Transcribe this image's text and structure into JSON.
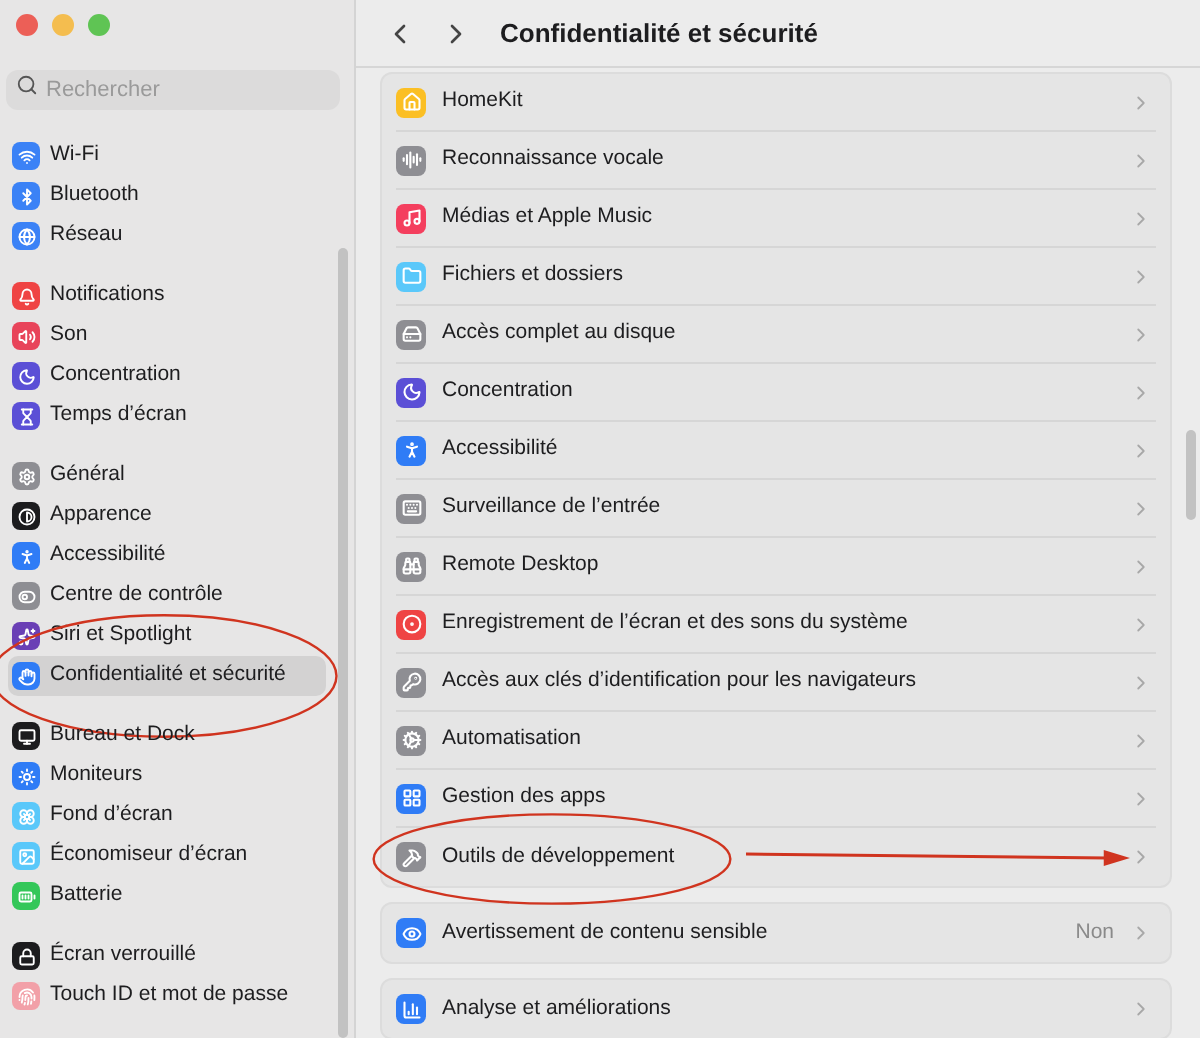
{
  "window": {
    "title": "Confidentialité et sécurité"
  },
  "sidebar": {
    "search": {
      "placeholder": "Rechercher"
    },
    "groups": [
      [
        {
          "label": "Wi-Fi",
          "color": "#3b82f6",
          "selected": false,
          "circled": false
        },
        {
          "label": "Bluetooth",
          "color": "#3b82f6",
          "selected": false,
          "circled": false
        },
        {
          "label": "Réseau",
          "color": "#3b82f6",
          "selected": false,
          "circled": false
        }
      ],
      [
        {
          "label": "Notifications",
          "color": "#ef4444",
          "selected": false,
          "circled": false
        },
        {
          "label": "Son",
          "color": "#e8445a",
          "selected": false,
          "circled": false
        },
        {
          "label": "Concentration",
          "color": "#5b4fd6",
          "selected": false,
          "circled": false
        },
        {
          "label": "Temps d’écran",
          "color": "#5b4fd6",
          "selected": false,
          "circled": false
        }
      ],
      [
        {
          "label": "Général",
          "color": "#8e8e93",
          "selected": false,
          "circled": false
        },
        {
          "label": "Apparence",
          "color": "#1c1c1e",
          "selected": false,
          "circled": false
        },
        {
          "label": "Accessibilité",
          "color": "#2f7cf6",
          "selected": false,
          "circled": false
        },
        {
          "label": "Centre de contrôle",
          "color": "#8e8e93",
          "selected": false,
          "circled": false
        },
        {
          "label": "Siri et Spotlight",
          "color": "#6a3fb5",
          "selected": false,
          "circled": false
        },
        {
          "label": "Confidentialité et sécurité",
          "color": "#2f7cf6",
          "selected": true,
          "circled": true
        }
      ],
      [
        {
          "label": "Bureau et Dock",
          "color": "#1c1c1e",
          "selected": false,
          "circled": false
        },
        {
          "label": "Moniteurs",
          "color": "#2f7cf6",
          "selected": false,
          "circled": false
        },
        {
          "label": "Fond d’écran",
          "color": "#5ac8fa",
          "selected": false,
          "circled": false
        },
        {
          "label": "Économiseur d’écran",
          "color": "#5ac8fa",
          "selected": false,
          "circled": false
        },
        {
          "label": "Batterie",
          "color": "#34c759",
          "selected": false,
          "circled": false
        }
      ],
      [
        {
          "label": "Écran verrouillé",
          "color": "#1c1c1e",
          "selected": false,
          "circled": false
        },
        {
          "label": "Touch ID et mot de passe",
          "color": "#f2a0a8",
          "selected": false,
          "circled": false
        }
      ]
    ]
  },
  "groups": [
    [
      {
        "label": "HomeKit",
        "color": "#fbbf24",
        "circled": false,
        "arrow": false
      },
      {
        "label": "Reconnaissance vocale",
        "color": "#8e8e93",
        "circled": false,
        "arrow": false
      },
      {
        "label": "Médias et Apple Music",
        "color": "#f43f5e",
        "circled": false,
        "arrow": false
      },
      {
        "label": "Fichiers et dossiers",
        "color": "#5ac8fa",
        "circled": false,
        "arrow": false
      },
      {
        "label": "Accès complet au disque",
        "color": "#8e8e93",
        "circled": false,
        "arrow": false
      },
      {
        "label": "Concentration",
        "color": "#5b4fd6",
        "circled": false,
        "arrow": false
      },
      {
        "label": "Accessibilité",
        "color": "#2f7cf6",
        "circled": false,
        "arrow": false
      },
      {
        "label": "Surveillance de l’entrée",
        "color": "#8e8e93",
        "circled": false,
        "arrow": false
      },
      {
        "label": "Remote Desktop",
        "color": "#8e8e93",
        "circled": false,
        "arrow": false
      },
      {
        "label": "Enregistrement de l’écran et des sons du système",
        "color": "#ef4444",
        "circled": false,
        "arrow": false
      },
      {
        "label": "Accès aux clés d’identification pour les navigateurs",
        "color": "#8e8e93",
        "circled": false,
        "arrow": false
      },
      {
        "label": "Automatisation",
        "color": "#8e8e93",
        "circled": false,
        "arrow": false
      },
      {
        "label": "Gestion des apps",
        "color": "#2f7cf6",
        "circled": false,
        "arrow": false
      },
      {
        "label": "Outils de développement",
        "color": "#8e8e93",
        "circled": true,
        "arrow": true
      }
    ],
    [
      {
        "label": "Avertissement de contenu sensible",
        "value": "Non",
        "color": "#2f7cf6",
        "circled": false,
        "arrow": false
      }
    ],
    [
      {
        "label": "Analyse et améliorations",
        "color": "#2f7cf6",
        "circled": false,
        "arrow": false
      }
    ]
  ]
}
